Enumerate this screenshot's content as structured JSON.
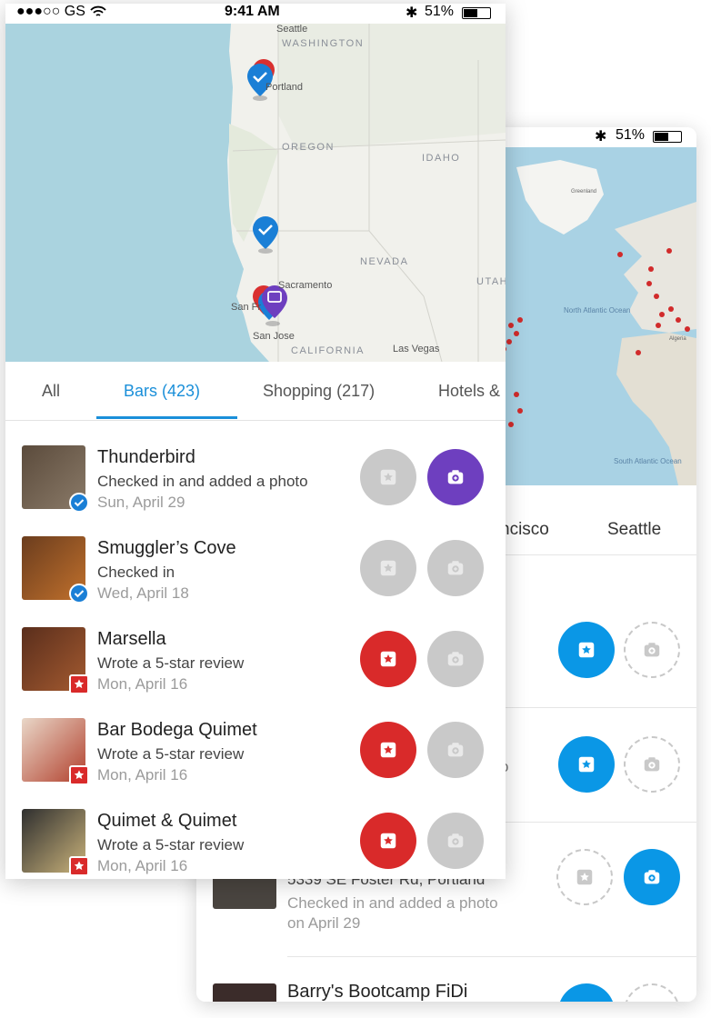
{
  "front": {
    "status": {
      "carrier": "●●●○○ GS",
      "time": "9:41 AM",
      "battery": "51%"
    },
    "map_labels": {
      "washington": "WASHINGTON",
      "oregon": "OREGON",
      "idaho": "IDAHO",
      "nevada": "NEVADA",
      "utah": "UTAH",
      "california": "CALIFORNIA",
      "seattle": "Seattle",
      "portland": "Portland",
      "sacramento": "Sacramento",
      "sanjose": "San Jose",
      "sanfrancisco": "San Fr",
      "lasvegas": "Las Vegas"
    },
    "tabs": [
      "All",
      "Bars (423)",
      "Shopping (217)",
      "Hotels &"
    ],
    "active_tab": "Bars (423)",
    "rows": [
      {
        "title": "Thunderbird",
        "subtitle": "Checked in and added a photo",
        "date": "Sun, April 29",
        "badge": "check",
        "star_active": false,
        "photo_active": true
      },
      {
        "title": "Smuggler’s Cove",
        "subtitle": "Checked in",
        "date": "Wed, April 18",
        "badge": "check",
        "star_active": false,
        "photo_active": false
      },
      {
        "title": "Marsella",
        "subtitle": "Wrote a 5-star review",
        "date": "Mon, April 16",
        "badge": "star",
        "star_active": true,
        "photo_active": false
      },
      {
        "title": "Bar Bodega Quimet",
        "subtitle": "Wrote a 5-star review",
        "date": "Mon, April 16",
        "badge": "star",
        "star_active": true,
        "photo_active": false
      },
      {
        "title": "Quimet & Quimet",
        "subtitle": "Wrote a 5-star review",
        "date": "Mon, April 16",
        "badge": "star",
        "star_active": true,
        "photo_active": false
      }
    ]
  },
  "back": {
    "status": {
      "battery": "51%"
    },
    "map_labels": {
      "greenland": "Greenland",
      "north_atlantic": "North\nAtlantic\nOcean",
      "south_atlantic": "South\nAtlantic\nOcean",
      "algeria": "Algeria"
    },
    "tabs": [
      "ncisco",
      "Seattle"
    ],
    "rows": [
      {
        "line1": "5339 SE Foster Rd, Portland",
        "line2": "Checked in and added a photo",
        "line3": "on April 29"
      },
      {
        "title": "Barry's Bootcamp FiDi"
      }
    ],
    "partial_text": "o"
  },
  "colors": {
    "blue": "#0a97e6",
    "red": "#d92a2a",
    "purple": "#6e3fbf",
    "grey": "#c9c9c9",
    "tab_active": "#1a8fd9"
  }
}
